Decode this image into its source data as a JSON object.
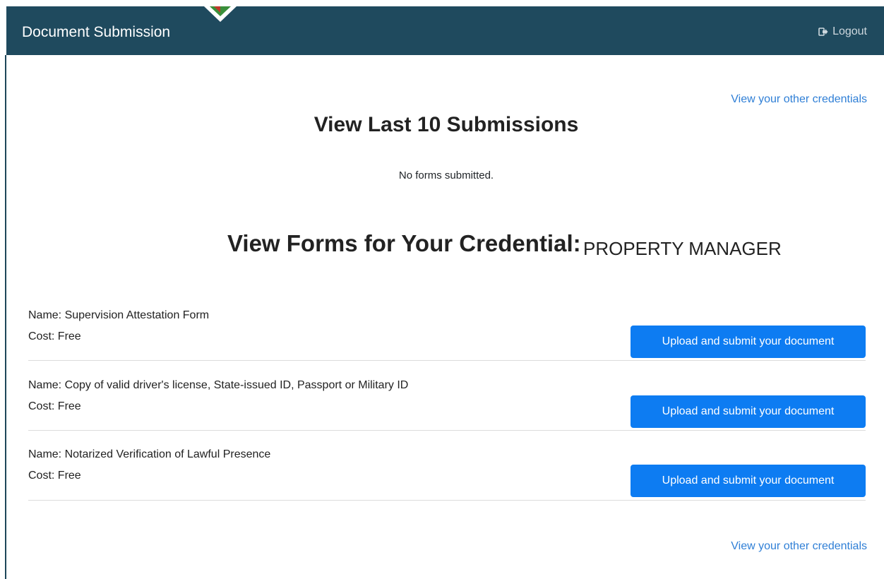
{
  "header": {
    "title": "Document Submission",
    "logout_label": "Logout"
  },
  "links": {
    "other_credentials_top": "View your other credentials",
    "other_credentials_bottom": "View your other credentials"
  },
  "submissions": {
    "heading": "View Last 10 Submissions",
    "empty_message": "No forms submitted."
  },
  "credential_section": {
    "heading": "View Forms for Your Credential:",
    "credential_name": "PROPERTY MANAGER"
  },
  "forms": [
    {
      "name": "Name: Supervision Attestation Form",
      "cost": "Cost: Free",
      "button": "Upload and submit your document"
    },
    {
      "name": "Name: Copy of valid driver's license, State-issued ID, Passport or Military ID",
      "cost": "Cost: Free",
      "button": "Upload and submit your document"
    },
    {
      "name": "Name: Notarized Verification of Lawful Presence",
      "cost": "Cost: Free",
      "button": "Upload and submit your document"
    }
  ],
  "colors": {
    "header_bg": "#1f4a5e",
    "button_bg": "#0d7cf2",
    "link": "#2f7fd6"
  }
}
